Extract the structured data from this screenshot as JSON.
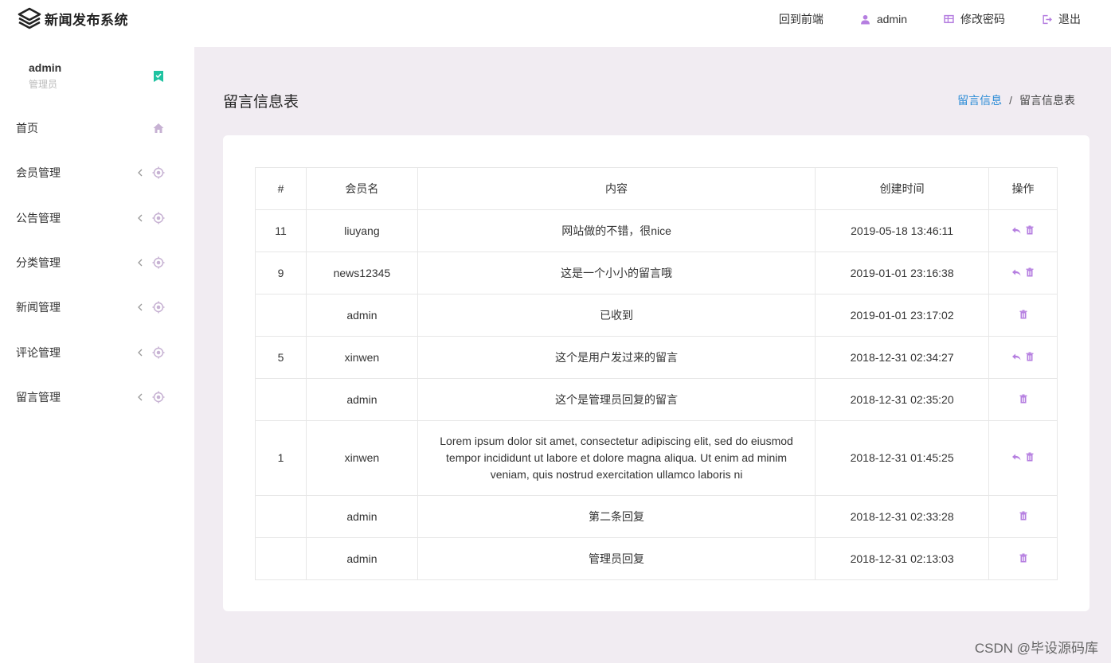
{
  "app": {
    "title": "新闻发布系统"
  },
  "topnav": {
    "home": "回到前端",
    "user": "admin",
    "password": "修改密码",
    "logout": "退出"
  },
  "sidebar": {
    "user": {
      "name": "admin",
      "role": "管理员"
    },
    "items": [
      {
        "label": "首页",
        "icon": "home-icon"
      },
      {
        "label": "会员管理",
        "icon": "target-icon"
      },
      {
        "label": "公告管理",
        "icon": "target-icon"
      },
      {
        "label": "分类管理",
        "icon": "target-icon"
      },
      {
        "label": "新闻管理",
        "icon": "target-icon"
      },
      {
        "label": "评论管理",
        "icon": "target-icon"
      },
      {
        "label": "留言管理",
        "icon": "target-icon"
      }
    ]
  },
  "page": {
    "title": "留言信息表",
    "breadcrumb": {
      "parent": "留言信息",
      "sep": "/",
      "current": "留言信息表"
    }
  },
  "table": {
    "headers": [
      "#",
      "会员名",
      "内容",
      "创建时间",
      "操作"
    ],
    "rows": [
      {
        "id": "11",
        "member": "liuyang",
        "content": "网站做的不错，很nice",
        "time": "2019-05-18 13:46:11",
        "reply": true
      },
      {
        "id": "9",
        "member": "news12345",
        "content": "这是一个小小的留言哦",
        "time": "2019-01-01 23:16:38",
        "reply": true
      },
      {
        "id": "",
        "member": "admin",
        "content": "已收到",
        "time": "2019-01-01 23:17:02",
        "reply": false
      },
      {
        "id": "5",
        "member": "xinwen",
        "content": "这个是用户发过来的留言",
        "time": "2018-12-31 02:34:27",
        "reply": true
      },
      {
        "id": "",
        "member": "admin",
        "content": "这个是管理员回复的留言",
        "time": "2018-12-31 02:35:20",
        "reply": false
      },
      {
        "id": "1",
        "member": "xinwen",
        "content": "Lorem ipsum dolor sit amet, consectetur adipiscing elit, sed do eiusmod tempor incididunt ut labore et dolore magna aliqua. Ut enim ad minim veniam, quis nostrud exercitation ullamco laboris ni",
        "time": "2018-12-31 01:45:25",
        "reply": true
      },
      {
        "id": "",
        "member": "admin",
        "content": "第二条回复",
        "time": "2018-12-31 02:33:28",
        "reply": false
      },
      {
        "id": "",
        "member": "admin",
        "content": "管理员回复",
        "time": "2018-12-31 02:13:03",
        "reply": false
      }
    ]
  },
  "colors": {
    "accent": "#b57ee0",
    "link": "#2a8bd6",
    "badge": "#1fc3a1",
    "icon_muted": "#c7b2d3"
  },
  "watermark": "CSDN @毕设源码库"
}
